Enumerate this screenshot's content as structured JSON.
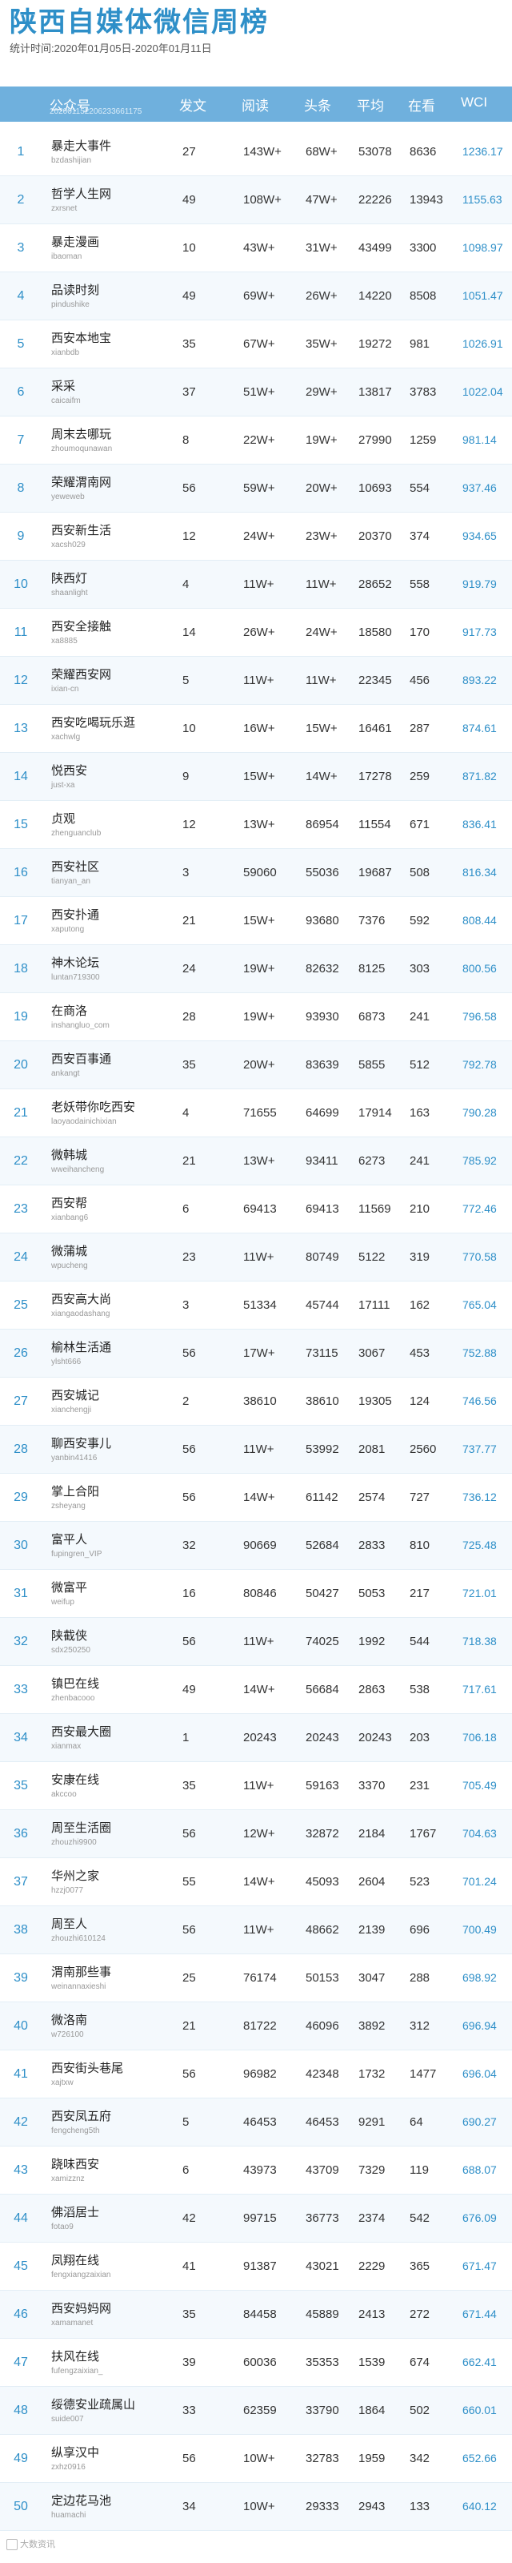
{
  "page": {
    "title": "陕西自媒体微信周榜",
    "period": "统计时间:2020年01月05日-2020年01月11日",
    "batch_id": "202001152206233661175"
  },
  "table": {
    "headers": [
      "公众号",
      "发文",
      "阅读",
      "头条",
      "平均",
      "在看",
      "WCI"
    ],
    "rows": [
      {
        "rank": "1",
        "name": "暴走大事件",
        "id": "bzdashijian",
        "posts": "27",
        "reads": "143W+",
        "heads": "68W+",
        "avg": "53078",
        "max": "8636",
        "wci": "1236.17"
      },
      {
        "rank": "2",
        "name": "哲学人生网",
        "id": "zxrsnet",
        "posts": "49",
        "reads": "108W+",
        "heads": "47W+",
        "avg": "22226",
        "max": "13943",
        "wci": "1155.63"
      },
      {
        "rank": "3",
        "name": "暴走漫画",
        "id": "ibaoman",
        "posts": "10",
        "reads": "43W+",
        "heads": "31W+",
        "avg": "43499",
        "max": "3300",
        "wci": "1098.97"
      },
      {
        "rank": "4",
        "name": "品读时刻",
        "id": "pindushike",
        "posts": "49",
        "reads": "69W+",
        "heads": "26W+",
        "avg": "14220",
        "max": "8508",
        "wci": "1051.47"
      },
      {
        "rank": "5",
        "name": "西安本地宝",
        "id": "xianbdb",
        "posts": "35",
        "reads": "67W+",
        "heads": "35W+",
        "avg": "19272",
        "max": "981",
        "wci": "1026.91"
      },
      {
        "rank": "6",
        "name": "采采",
        "id": "caicaifm",
        "posts": "37",
        "reads": "51W+",
        "heads": "29W+",
        "avg": "13817",
        "max": "3783",
        "wci": "1022.04"
      },
      {
        "rank": "7",
        "name": "周末去哪玩",
        "id": "zhoumoqunawan",
        "posts": "8",
        "reads": "22W+",
        "heads": "19W+",
        "avg": "27990",
        "max": "1259",
        "wci": "981.14"
      },
      {
        "rank": "8",
        "name": "荣耀渭南网",
        "id": "yeweweb",
        "posts": "56",
        "reads": "59W+",
        "heads": "20W+",
        "avg": "10693",
        "max": "554",
        "wci": "937.46"
      },
      {
        "rank": "9",
        "name": "西安新生活",
        "id": "xacsh029",
        "posts": "12",
        "reads": "24W+",
        "heads": "23W+",
        "avg": "20370",
        "max": "374",
        "wci": "934.65"
      },
      {
        "rank": "10",
        "name": "陕西灯",
        "id": "shaanlight",
        "posts": "4",
        "reads": "11W+",
        "heads": "11W+",
        "avg": "28652",
        "max": "558",
        "wci": "919.79"
      },
      {
        "rank": "11",
        "name": "西安全接触",
        "id": "xa8885",
        "posts": "14",
        "reads": "26W+",
        "heads": "24W+",
        "avg": "18580",
        "max": "170",
        "wci": "917.73"
      },
      {
        "rank": "12",
        "name": "荣耀西安网",
        "id": "ixian-cn",
        "posts": "5",
        "reads": "11W+",
        "heads": "11W+",
        "avg": "22345",
        "max": "456",
        "wci": "893.22"
      },
      {
        "rank": "13",
        "name": "西安吃喝玩乐逛",
        "id": "xachwlg",
        "posts": "10",
        "reads": "16W+",
        "heads": "15W+",
        "avg": "16461",
        "max": "287",
        "wci": "874.61"
      },
      {
        "rank": "14",
        "name": "悦西安",
        "id": "just-xa",
        "posts": "9",
        "reads": "15W+",
        "heads": "14W+",
        "avg": "17278",
        "max": "259",
        "wci": "871.82"
      },
      {
        "rank": "15",
        "name": "贞观",
        "id": "zhenguanclub",
        "posts": "12",
        "reads": "13W+",
        "heads": "86954",
        "avg": "11554",
        "max": "671",
        "wci": "836.41"
      },
      {
        "rank": "16",
        "name": "西安社区",
        "id": "tianyan_an",
        "posts": "3",
        "reads": "59060",
        "heads": "55036",
        "avg": "19687",
        "max": "508",
        "wci": "816.34"
      },
      {
        "rank": "17",
        "name": "西安扑通",
        "id": "xaputong",
        "posts": "21",
        "reads": "15W+",
        "heads": "93680",
        "avg": "7376",
        "max": "592",
        "wci": "808.44"
      },
      {
        "rank": "18",
        "name": "神木论坛",
        "id": "luntan719300",
        "posts": "24",
        "reads": "19W+",
        "heads": "82632",
        "avg": "8125",
        "max": "303",
        "wci": "800.56"
      },
      {
        "rank": "19",
        "name": "在商洛",
        "id": "inshangluo_com",
        "posts": "28",
        "reads": "19W+",
        "heads": "93930",
        "avg": "6873",
        "max": "241",
        "wci": "796.58"
      },
      {
        "rank": "20",
        "name": "西安百事通",
        "id": "ankangt",
        "posts": "35",
        "reads": "20W+",
        "heads": "83639",
        "avg": "5855",
        "max": "512",
        "wci": "792.78"
      },
      {
        "rank": "21",
        "name": "老妖带你吃西安",
        "id": "laoyaodainichixian",
        "posts": "4",
        "reads": "71655",
        "heads": "64699",
        "avg": "17914",
        "max": "163",
        "wci": "790.28"
      },
      {
        "rank": "22",
        "name": "微韩城",
        "id": "wweihancheng",
        "posts": "21",
        "reads": "13W+",
        "heads": "93411",
        "avg": "6273",
        "max": "241",
        "wci": "785.92"
      },
      {
        "rank": "23",
        "name": "西安帮",
        "id": "xianbang6",
        "posts": "6",
        "reads": "69413",
        "heads": "69413",
        "avg": "11569",
        "max": "210",
        "wci": "772.46"
      },
      {
        "rank": "24",
        "name": "微蒲城",
        "id": "wpucheng",
        "posts": "23",
        "reads": "11W+",
        "heads": "80749",
        "avg": "5122",
        "max": "319",
        "wci": "770.58"
      },
      {
        "rank": "25",
        "name": "西安高大尚",
        "id": "xiangaodashang",
        "posts": "3",
        "reads": "51334",
        "heads": "45744",
        "avg": "17111",
        "max": "162",
        "wci": "765.04"
      },
      {
        "rank": "26",
        "name": "榆林生活通",
        "id": "ylsht666",
        "posts": "56",
        "reads": "17W+",
        "heads": "73115",
        "avg": "3067",
        "max": "453",
        "wci": "752.88"
      },
      {
        "rank": "27",
        "name": "西安城记",
        "id": "xianchengji",
        "posts": "2",
        "reads": "38610",
        "heads": "38610",
        "avg": "19305",
        "max": "124",
        "wci": "746.56"
      },
      {
        "rank": "28",
        "name": "聊西安事儿",
        "id": "yanbin41416",
        "posts": "56",
        "reads": "11W+",
        "heads": "53992",
        "avg": "2081",
        "max": "2560",
        "wci": "737.77"
      },
      {
        "rank": "29",
        "name": "掌上合阳",
        "id": "zsheyang",
        "posts": "56",
        "reads": "14W+",
        "heads": "61142",
        "avg": "2574",
        "max": "727",
        "wci": "736.12"
      },
      {
        "rank": "30",
        "name": "富平人",
        "id": "fupingren_VIP",
        "posts": "32",
        "reads": "90669",
        "heads": "52684",
        "avg": "2833",
        "max": "810",
        "wci": "725.48"
      },
      {
        "rank": "31",
        "name": "微富平",
        "id": "weifup",
        "posts": "16",
        "reads": "80846",
        "heads": "50427",
        "avg": "5053",
        "max": "217",
        "wci": "721.01"
      },
      {
        "rank": "32",
        "name": "陕截侠",
        "id": "sdx250250",
        "posts": "56",
        "reads": "11W+",
        "heads": "74025",
        "avg": "1992",
        "max": "544",
        "wci": "718.38"
      },
      {
        "rank": "33",
        "name": "镇巴在线",
        "id": "zhenbacooo",
        "posts": "49",
        "reads": "14W+",
        "heads": "56684",
        "avg": "2863",
        "max": "538",
        "wci": "717.61"
      },
      {
        "rank": "34",
        "name": "西安最大圈",
        "id": "xianmax",
        "posts": "1",
        "reads": "20243",
        "heads": "20243",
        "avg": "20243",
        "max": "203",
        "wci": "706.18"
      },
      {
        "rank": "35",
        "name": "安康在线",
        "id": "akccoo",
        "posts": "35",
        "reads": "11W+",
        "heads": "59163",
        "avg": "3370",
        "max": "231",
        "wci": "705.49"
      },
      {
        "rank": "36",
        "name": "周至生活圈",
        "id": "zhouzhi9900",
        "posts": "56",
        "reads": "12W+",
        "heads": "32872",
        "avg": "2184",
        "max": "1767",
        "wci": "704.63"
      },
      {
        "rank": "37",
        "name": "华州之家",
        "id": "hzzj0077",
        "posts": "55",
        "reads": "14W+",
        "heads": "45093",
        "avg": "2604",
        "max": "523",
        "wci": "701.24"
      },
      {
        "rank": "38",
        "name": "周至人",
        "id": "zhouzhi610124",
        "posts": "56",
        "reads": "11W+",
        "heads": "48662",
        "avg": "2139",
        "max": "696",
        "wci": "700.49"
      },
      {
        "rank": "39",
        "name": "渭南那些事",
        "id": "weinannaxieshi",
        "posts": "25",
        "reads": "76174",
        "heads": "50153",
        "avg": "3047",
        "max": "288",
        "wci": "698.92"
      },
      {
        "rank": "40",
        "name": "微洛南",
        "id": "w726100",
        "posts": "21",
        "reads": "81722",
        "heads": "46096",
        "avg": "3892",
        "max": "312",
        "wci": "696.94"
      },
      {
        "rank": "41",
        "name": "西安街头巷尾",
        "id": "xajtxw",
        "posts": "56",
        "reads": "96982",
        "heads": "42348",
        "avg": "1732",
        "max": "1477",
        "wci": "696.04"
      },
      {
        "rank": "42",
        "name": "西安凤五府",
        "id": "fengcheng5th",
        "posts": "5",
        "reads": "46453",
        "heads": "46453",
        "avg": "9291",
        "max": "64",
        "wci": "690.27"
      },
      {
        "rank": "43",
        "name": "跷味西安",
        "id": "xamizznz",
        "posts": "6",
        "reads": "43973",
        "heads": "43709",
        "avg": "7329",
        "max": "119",
        "wci": "688.07"
      },
      {
        "rank": "44",
        "name": "佛滔居士",
        "id": "fotao9",
        "posts": "42",
        "reads": "99715",
        "heads": "36773",
        "avg": "2374",
        "max": "542",
        "wci": "676.09"
      },
      {
        "rank": "45",
        "name": "凤翔在线",
        "id": "fengxiangzaixian",
        "posts": "41",
        "reads": "91387",
        "heads": "43021",
        "avg": "2229",
        "max": "365",
        "wci": "671.47"
      },
      {
        "rank": "46",
        "name": "西安妈妈网",
        "id": "xamamanet",
        "posts": "35",
        "reads": "84458",
        "heads": "45889",
        "avg": "2413",
        "max": "272",
        "wci": "671.44"
      },
      {
        "rank": "47",
        "name": "扶风在线",
        "id": "fufengzaixian_",
        "posts": "39",
        "reads": "60036",
        "heads": "35353",
        "avg": "1539",
        "max": "674",
        "wci": "662.41"
      },
      {
        "rank": "48",
        "name": "绥德安业疏属山",
        "id": "suide007",
        "posts": "33",
        "reads": "62359",
        "heads": "33790",
        "avg": "1864",
        "max": "502",
        "wci": "660.01"
      },
      {
        "rank": "49",
        "name": "纵享汉中",
        "id": "zxhz0916",
        "posts": "56",
        "reads": "10W+",
        "heads": "32783",
        "avg": "1959",
        "max": "342",
        "wci": "652.66"
      },
      {
        "rank": "50",
        "name": "定边花马池",
        "id": "huamachi",
        "posts": "34",
        "reads": "10W+",
        "heads": "29333",
        "avg": "2943",
        "max": "133",
        "wci": "640.12"
      }
    ]
  },
  "footer": {
    "watermark": "大数资讯"
  }
}
